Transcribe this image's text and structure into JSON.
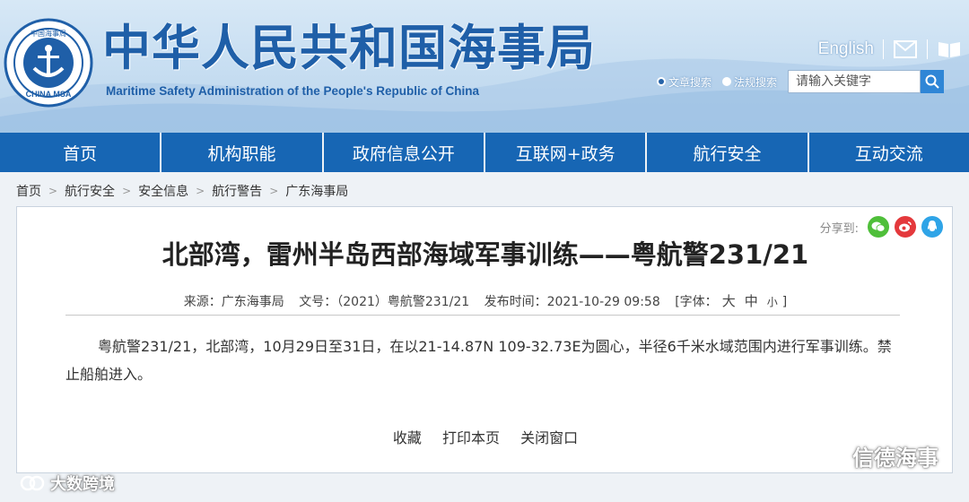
{
  "header": {
    "title_cn": "中华人民共和国海事局",
    "title_en": "Maritime Safety Administration of the People's Republic of China",
    "logo_text_top": "中国海事局",
    "logo_text_bottom": "CHINA MSA",
    "lang_link": "English",
    "search": {
      "option1": "文章搜索",
      "option2": "法规搜索",
      "placeholder": "请输入关键字"
    }
  },
  "nav": [
    {
      "label": "首页"
    },
    {
      "label": "机构职能"
    },
    {
      "label": "政府信息公开"
    },
    {
      "label": "互联网+政务"
    },
    {
      "label": "航行安全"
    },
    {
      "label": "互动交流"
    }
  ],
  "breadcrumb": [
    "首页",
    "航行安全",
    "安全信息",
    "航行警告",
    "广东海事局"
  ],
  "article": {
    "share_label": "分享到:",
    "title": "北部湾，雷州半岛西部海域军事训练——粤航警231/21",
    "meta": {
      "source": "来源：广东海事局",
      "doc_no": "文号：（2021）粤航警231/21",
      "published": "发布时间：2021-10-29 09:58",
      "font_label": "[字体：",
      "font_big": "大",
      "font_mid": "中",
      "font_small": "小",
      "font_close": "]"
    },
    "body": "粤航警231/21，北部湾，10月29日至31日，在以21-14.87N 109-32.73E为圆心，半径6千米水域范围内进行军事训练。禁止船舶进入。",
    "actions": [
      "收藏",
      "打印本页",
      "关闭窗口"
    ]
  },
  "watermarks": {
    "right": "信德海事",
    "left": "大数跨境"
  },
  "colors": {
    "brand_blue": "#1766b4",
    "title_blue": "#1f5fa8"
  }
}
